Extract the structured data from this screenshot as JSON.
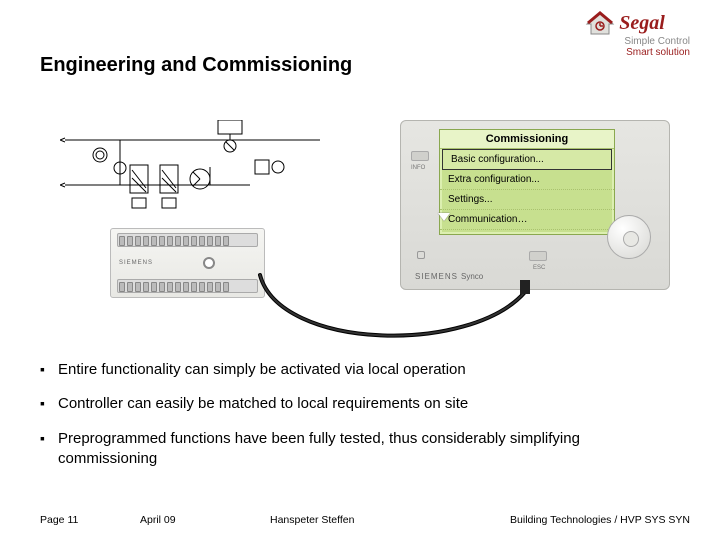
{
  "logo": {
    "name": "Segal",
    "line1": "Simple Control",
    "line2": "Smart solution"
  },
  "title": "Engineering and Commissioning",
  "panel": {
    "brand": "SIEMENS",
    "series": "Synco",
    "info_btn": "INFO",
    "esc_btn": "ESC",
    "screen": {
      "title": "Commissioning",
      "rows": [
        "Basic configuration...",
        "Extra configuration...",
        "Settings...",
        "Communication"
      ]
    }
  },
  "device": {
    "brand": "SIEMENS"
  },
  "bullets": [
    "Entire functionality can simply be activated via local operation",
    "Controller can easily be matched to local requirements on site",
    "Preprogrammed functions have been fully tested, thus considerably simplifying commissioning"
  ],
  "footer": {
    "page": "Page 11",
    "date": "April 09",
    "author": "Hanspeter Steffen",
    "right": "Building Technologies / HVP SYS SYN"
  }
}
